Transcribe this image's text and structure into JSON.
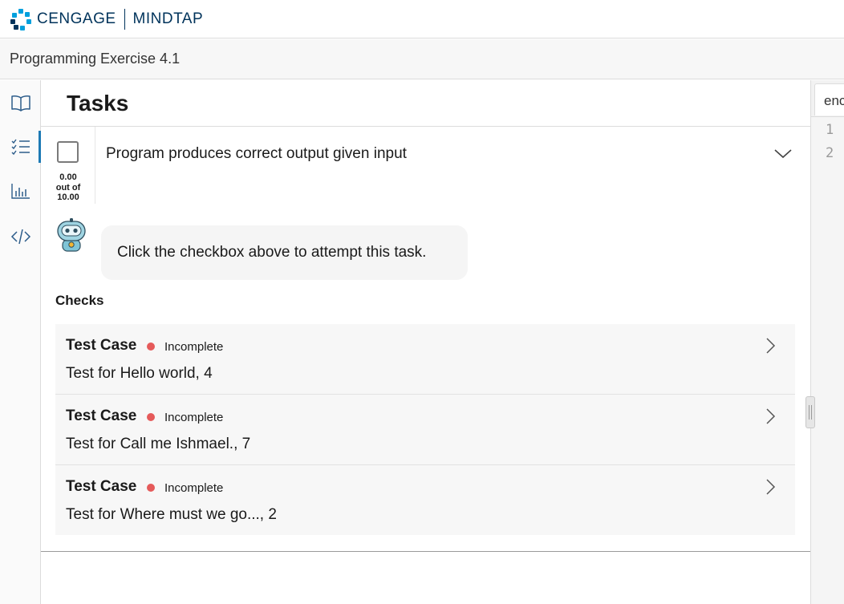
{
  "brand": {
    "company": "CENGAGE",
    "product": "MINDTAP",
    "logo_colors": [
      "#00a0dd",
      "#00335b"
    ]
  },
  "page": {
    "title": "Programming Exercise 4.1"
  },
  "sidebar": {
    "items": [
      {
        "icon": "book-icon",
        "active": false
      },
      {
        "icon": "checklist-icon",
        "active": true
      },
      {
        "icon": "bar-chart-icon",
        "active": false
      },
      {
        "icon": "code-icon",
        "active": false
      }
    ]
  },
  "tasks": {
    "heading": "Tasks",
    "task": {
      "label": "Program produces correct output given input",
      "score_line1": "0.00",
      "score_line2": "out of",
      "score_line3": "10.00",
      "checked": false
    },
    "assistant_message": "Click the checkbox above to attempt this task.",
    "checks_heading": "Checks",
    "checks": [
      {
        "title": "Test Case",
        "status": "Incomplete",
        "description": "Test for Hello world, 4"
      },
      {
        "title": "Test Case",
        "status": "Incomplete",
        "description": "Test for Call me Ishmael., 7"
      },
      {
        "title": "Test Case",
        "status": "Incomplete",
        "description": "Test for Where must we go..., 2"
      }
    ],
    "status_color": "#e55a5a"
  },
  "editor": {
    "tab_label": "enc",
    "line_numbers": [
      "1",
      "2"
    ]
  }
}
